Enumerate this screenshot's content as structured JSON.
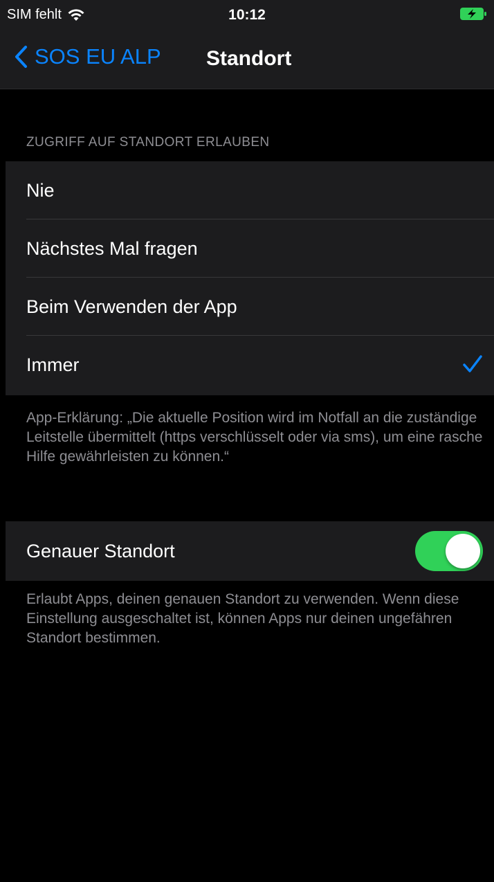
{
  "status_bar": {
    "carrier": "SIM fehlt",
    "time": "10:12",
    "icons": [
      "wifi-icon",
      "battery-charging-icon"
    ],
    "battery_color": "#30d158"
  },
  "nav": {
    "back_label": "SOS EU ALP",
    "title": "Standort"
  },
  "location_access": {
    "header": "ZUGRIFF AUF STANDORT ERLAUBEN",
    "options": [
      {
        "label": "Nie",
        "selected": false
      },
      {
        "label": "Nächstes Mal fragen",
        "selected": false
      },
      {
        "label": "Beim Verwenden der App",
        "selected": false
      },
      {
        "label": "Immer",
        "selected": true
      }
    ],
    "explanation": "App-Erklärung: „Die aktuelle Position wird im Notfall an die zuständige Leitstelle übermittelt (https verschlüsselt oder via sms), um eine rasche Hilfe gewährleisten zu können.“"
  },
  "precise_location": {
    "label": "Genauer Standort",
    "enabled": true,
    "footer": "Erlaubt Apps, deinen genauen Standort zu verwenden. Wenn diese Einstellung ausgeschaltet ist, können Apps nur deinen ungefähren Standort bestimmen."
  },
  "colors": {
    "accent": "#0a84ff",
    "toggle_on": "#30d158",
    "background": "#000000",
    "cell": "#1c1c1e",
    "secondary_text": "#8e8e93"
  }
}
